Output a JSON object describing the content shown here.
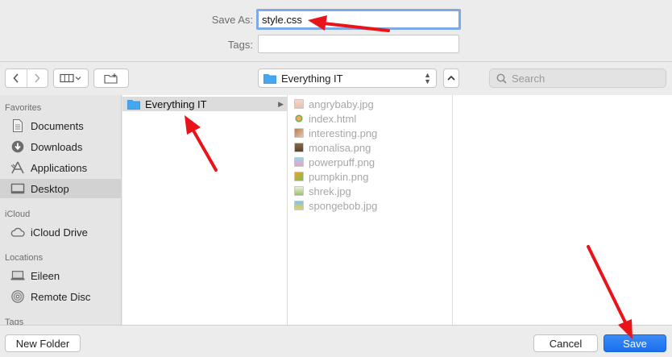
{
  "form": {
    "save_as_label": "Save As:",
    "save_as_value": "style.css",
    "tags_label": "Tags:",
    "tags_value": ""
  },
  "toolbar": {
    "back_icon": "chevron-left-icon",
    "forward_icon": "chevron-right-icon",
    "view_icon": "column-view-icon",
    "new_folder_icon": "new-folder-icon",
    "location": "Everything IT",
    "search_placeholder": "Search"
  },
  "sidebar": {
    "sections": [
      {
        "heading": "Favorites",
        "items": [
          {
            "label": "Documents",
            "icon": "document-icon",
            "selected": false
          },
          {
            "label": "Downloads",
            "icon": "download-icon",
            "selected": false
          },
          {
            "label": "Applications",
            "icon": "applications-icon",
            "selected": false
          },
          {
            "label": "Desktop",
            "icon": "desktop-icon",
            "selected": true
          }
        ]
      },
      {
        "heading": "iCloud",
        "items": [
          {
            "label": "iCloud Drive",
            "icon": "cloud-icon",
            "selected": false
          }
        ]
      },
      {
        "heading": "Locations",
        "items": [
          {
            "label": "Eileen",
            "icon": "laptop-icon",
            "selected": false
          },
          {
            "label": "Remote Disc",
            "icon": "disc-icon",
            "selected": false
          }
        ]
      },
      {
        "heading": "Tags",
        "items": []
      }
    ]
  },
  "browser": {
    "folder": "Everything IT",
    "files": [
      "angrybaby.jpg",
      "index.html",
      "interesting.png",
      "monalisa.png",
      "powerpuff.png",
      "pumpkin.png",
      "shrek.jpg",
      "spongebob.jpg"
    ]
  },
  "buttons": {
    "new_folder": "New Folder",
    "cancel": "Cancel",
    "save": "Save"
  },
  "colors": {
    "accent": "#1b6ff0",
    "annotation": "#e8141a",
    "folder": "#3aa3ee"
  }
}
